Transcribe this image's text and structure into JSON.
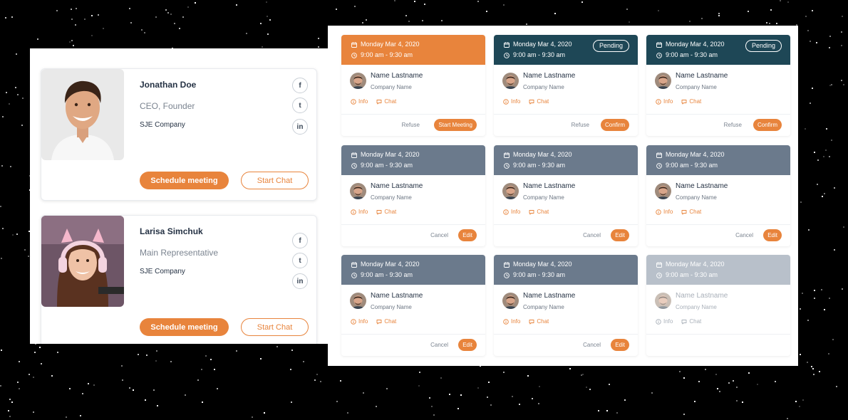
{
  "profiles": [
    {
      "name": "Jonathan Doe",
      "role": "CEO, Founder",
      "company": "SJE Company",
      "schedule_label": "Schedule meeting",
      "chat_label": "Start Chat",
      "social": [
        "facebook",
        "twitter",
        "linkedin"
      ]
    },
    {
      "name": "Larisa Simchuk",
      "role": "Main Representative",
      "company": "SJE Company",
      "schedule_label": "Schedule meeting",
      "chat_label": "Start Chat",
      "social": [
        "facebook",
        "twitter",
        "linkedin"
      ]
    }
  ],
  "social_glyphs": {
    "facebook": "f",
    "twitter": "t",
    "linkedin": "in"
  },
  "colors": {
    "accent": "#e8843c",
    "teal_header": "#1e4756",
    "slate_header": "#6b7a8c",
    "disabled_header": "#b8c0ca",
    "text_dark": "#253244"
  },
  "meetings": [
    {
      "date": "Monday Mar 4, 2020",
      "time": "9:00 am - 9:30 am",
      "header": "orange",
      "status": "",
      "name": "Name Lastname",
      "company": "Company Name",
      "info_label": "Info",
      "chat_label": "Chat",
      "secondary": "Refuse",
      "primary": "Start Meeting",
      "dim": false
    },
    {
      "date": "Monday Mar 4, 2020",
      "time": "9:00 am - 9:30 am",
      "header": "teal",
      "status": "Pending",
      "name": "Name Lastname",
      "company": "Company Name",
      "info_label": "Info",
      "chat_label": "Chat",
      "secondary": "Refuse",
      "primary": "Confirm",
      "dim": false
    },
    {
      "date": "Monday Mar 4, 2020",
      "time": "9:00 am - 9:30 am",
      "header": "teal",
      "status": "Pending",
      "name": "Name Lastname",
      "company": "Company Name",
      "info_label": "Info",
      "chat_label": "Chat",
      "secondary": "Refuse",
      "primary": "Confirm",
      "dim": false
    },
    {
      "date": "Monday Mar 4, 2020",
      "time": "9:00 am - 9:30 am",
      "header": "slate",
      "status": "",
      "name": "Name Lastname",
      "company": "Company Name",
      "info_label": "Info",
      "chat_label": "Chat",
      "secondary": "Cancel",
      "primary": "Edit",
      "dim": false
    },
    {
      "date": "Monday Mar 4, 2020",
      "time": "9:00 am - 9:30 am",
      "header": "slate",
      "status": "",
      "name": "Name Lastname",
      "company": "Company Name",
      "info_label": "Info",
      "chat_label": "Chat",
      "secondary": "Cancel",
      "primary": "Edit",
      "dim": false
    },
    {
      "date": "Monday Mar 4, 2020",
      "time": "9:00 am - 9:30 am",
      "header": "slate",
      "status": "",
      "name": "Name Lastname",
      "company": "Company Name",
      "info_label": "Info",
      "chat_label": "Chat",
      "secondary": "Cancel",
      "primary": "Edit",
      "dim": false
    },
    {
      "date": "Monday Mar 4, 2020",
      "time": "9:00 am - 9:30 am",
      "header": "slate",
      "status": "",
      "name": "Name Lastname",
      "company": "Company Name",
      "info_label": "Info",
      "chat_label": "Chat",
      "secondary": "Cancel",
      "primary": "Edit",
      "dim": false
    },
    {
      "date": "Monday Mar 4, 2020",
      "time": "9:00 am - 9:30 am",
      "header": "slate",
      "status": "",
      "name": "Name Lastname",
      "company": "Company Name",
      "info_label": "Info",
      "chat_label": "Chat",
      "secondary": "Cancel",
      "primary": "Edit",
      "dim": false
    },
    {
      "date": "Monday Mar 4, 2020",
      "time": "9:00 am - 9:30 am",
      "header": "light",
      "status": "",
      "name": "Name Lastname",
      "company": "Company Name",
      "info_label": "Info",
      "chat_label": "Chat",
      "secondary": "",
      "primary": "",
      "dim": true
    }
  ]
}
